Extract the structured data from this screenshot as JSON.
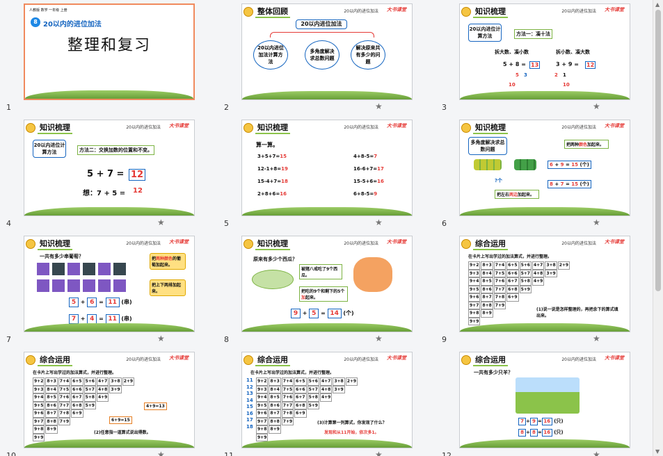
{
  "slides": [
    {
      "num": "1",
      "badge": "8",
      "header": "20以内的进位加法",
      "title": "整理和复习",
      "small": "人教版 数学 一年级 上册"
    },
    {
      "num": "2",
      "header": "整体回顾",
      "center": "20以内进位加法",
      "ovals": [
        "20以内进位加法计算方法",
        "多角度解决求总数问题",
        "解决原来共有多少的问题"
      ]
    },
    {
      "num": "3",
      "header": "知识梳理",
      "left": "20以内进位计算方法",
      "method": "方法一：凑十法",
      "l1": "拆大数、凑小数",
      "l2": "拆小数、凑大数",
      "eq1": "5 + 8 =",
      "ans1": "13",
      "s1a": "5",
      "s1b": "3",
      "t1": "10",
      "eq2": "3 + 9 =",
      "ans2": "12",
      "s2a": "2",
      "s2b": "1",
      "t2": "10"
    },
    {
      "num": "4",
      "header": "知识梳理",
      "left": "20以内进位计算方法",
      "method": "方法二：交换加数的位置和不变。",
      "eq1": "5 + 7 =",
      "ans1": "12",
      "eq2": "想：7 + 5 =",
      "ans2": "12"
    },
    {
      "num": "5",
      "header": "知识梳理",
      "intro": "算一算。",
      "rows": [
        [
          "3+5+7=",
          "15",
          "4+8-5=",
          "7"
        ],
        [
          "12-1+8=",
          "19",
          "16-6+7=",
          "17"
        ],
        [
          "15-4+7=",
          "18",
          "15-5+6=",
          "16"
        ],
        [
          "2+8+6=",
          "16",
          "6+8-5=",
          "9"
        ]
      ]
    },
    {
      "num": "6",
      "header": "知识梳理",
      "left": "多角度解决求总数问题",
      "c1a": "把两种",
      "c1b": "颜色",
      "c1c": "加起来。",
      "c2a": "把左右",
      "c2b": "两边",
      "c2c": "加起来。",
      "q": "?个",
      "e1": [
        "6",
        "+",
        "9",
        "=",
        "15",
        "(个)"
      ],
      "e2": [
        "8",
        "+",
        "7",
        "=",
        "15",
        "(个)"
      ]
    },
    {
      "num": "7",
      "header": "知识梳理",
      "q": "一共有多少串葡萄？",
      "c1a": "把",
      "c1b": "两种颜色",
      "c1c": "的葡萄加起来。",
      "c2": "把上下两排加起来。",
      "e1": [
        "5",
        "+",
        "6",
        "=",
        "11",
        "(串)"
      ],
      "e2": [
        "7",
        "+",
        "4",
        "=",
        "11",
        "(串)"
      ]
    },
    {
      "num": "8",
      "header": "知识梳理",
      "q": "原来有多少个西瓜？",
      "c1": "被猪八戒吃了9个西瓜。",
      "c2a": "把吃的9个和剩下的5个",
      "c2b": "加",
      "c2c": "起来。",
      "e": [
        "9",
        "+",
        "5",
        "=",
        "14",
        "(个)"
      ]
    },
    {
      "num": "9",
      "header": "综合运用",
      "intro": "在卡片上写出学过的加法算式，并进行整理。",
      "note": "(1)说一说是怎样整理的，再把余下的算式填出来。"
    },
    {
      "num": "10",
      "header": "综合运用",
      "intro": "在卡片上写出学过的加法算式，并进行整理。",
      "cA": "4+9=13",
      "cB": "6+9=15",
      "note": "(2)任意指一道算式说出得数。"
    },
    {
      "num": "11",
      "header": "综合运用",
      "intro": "在卡片上写出学过的加法算式，并进行整理。",
      "nums": [
        "11",
        "12",
        "13",
        "14",
        "15",
        "16",
        "17",
        "18"
      ],
      "note": "(3)计算第一列算式，你发现了什么？",
      "note2": "发现和从11开始，依次多1。"
    },
    {
      "num": "12",
      "header": "综合运用",
      "q": "一共有多少只羊？",
      "e1": [
        "7",
        "+",
        "9",
        "=",
        "16",
        "(只)"
      ],
      "e2": [
        "8",
        "+",
        "8",
        "=",
        "16",
        "(只)"
      ]
    }
  ],
  "common": {
    "tag": "20以内的进位加法",
    "logo": "大书课堂"
  },
  "grid_rows": [
    [
      "9+2",
      "8+3",
      "7+4",
      "6+5",
      "5+6",
      "4+7",
      "3+8",
      "2+9"
    ],
    [
      "9+3",
      "8+4",
      "7+5",
      "6+6",
      "5+7",
      "4+8",
      "3+9"
    ],
    [
      "9+4",
      "8+5",
      "7+6",
      "6+7",
      "5+8",
      "4+9"
    ],
    [
      "9+5",
      "8+6",
      "7+7",
      "6+8",
      "5+9"
    ],
    [
      "9+6",
      "8+7",
      "7+8",
      "6+9"
    ],
    [
      "9+7",
      "8+8",
      "7+9"
    ],
    [
      "9+8",
      "8+9"
    ],
    [
      "9+9"
    ]
  ]
}
